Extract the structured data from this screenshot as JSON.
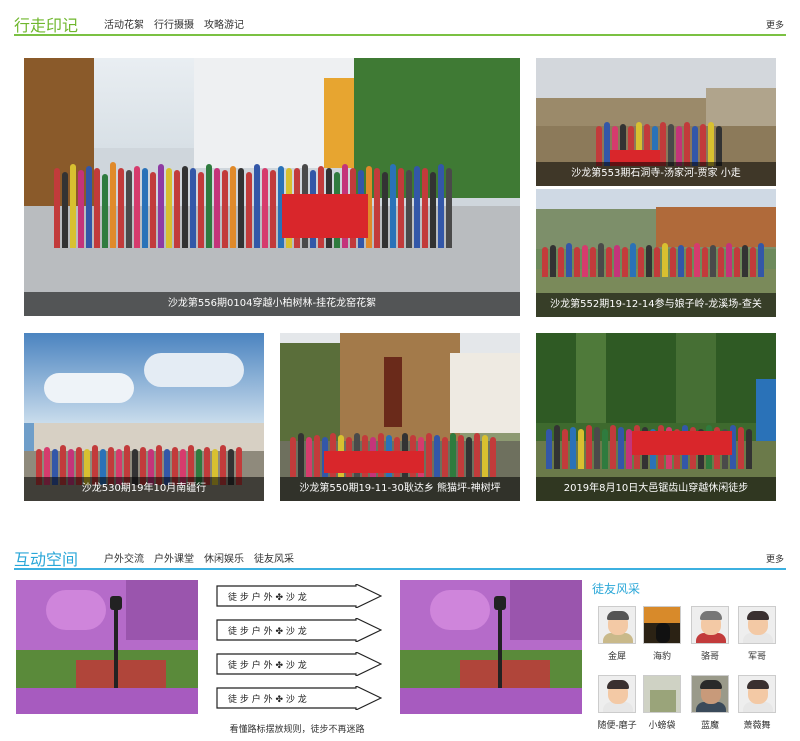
{
  "section1": {
    "title": "行走印记",
    "tabs": [
      "活动花絮",
      "行行摄摄",
      "攻略游记"
    ],
    "more": "更多",
    "tiles": [
      {
        "caption": "沙龙第556期0104穿越小柏树林-挂花龙窑花絮"
      },
      {
        "caption": "沙龙第553期石洞寺-汤家河-贾家 小走"
      },
      {
        "caption": "沙龙第552期19-12-14参与娘子岭-龙溪场-查关"
      },
      {
        "caption": "沙龙530期19年10月南疆行"
      },
      {
        "caption": "沙龙第550期19-11-30耿达乡 熊猫坪-神树坪"
      },
      {
        "caption": "2019年8月10日大邑锯齿山穿越休闲徒步"
      }
    ]
  },
  "section2": {
    "title": "互动空间",
    "tabs": [
      "户外交流",
      "户外课堂",
      "休闲娱乐",
      "徒友风采"
    ],
    "more": "更多",
    "sign_caption": "看懂路标摆放规则，徒步不再迷路",
    "heart": {
      "title": "徒友风采",
      "members": [
        "金犀",
        "海豹",
        "骆哥",
        "军哥",
        "随便-磨子",
        "小螃袋",
        "蓝魔",
        "萧薇舞"
      ]
    }
  },
  "colors": {
    "green": "#7bc143",
    "blue": "#3cb0e0"
  }
}
